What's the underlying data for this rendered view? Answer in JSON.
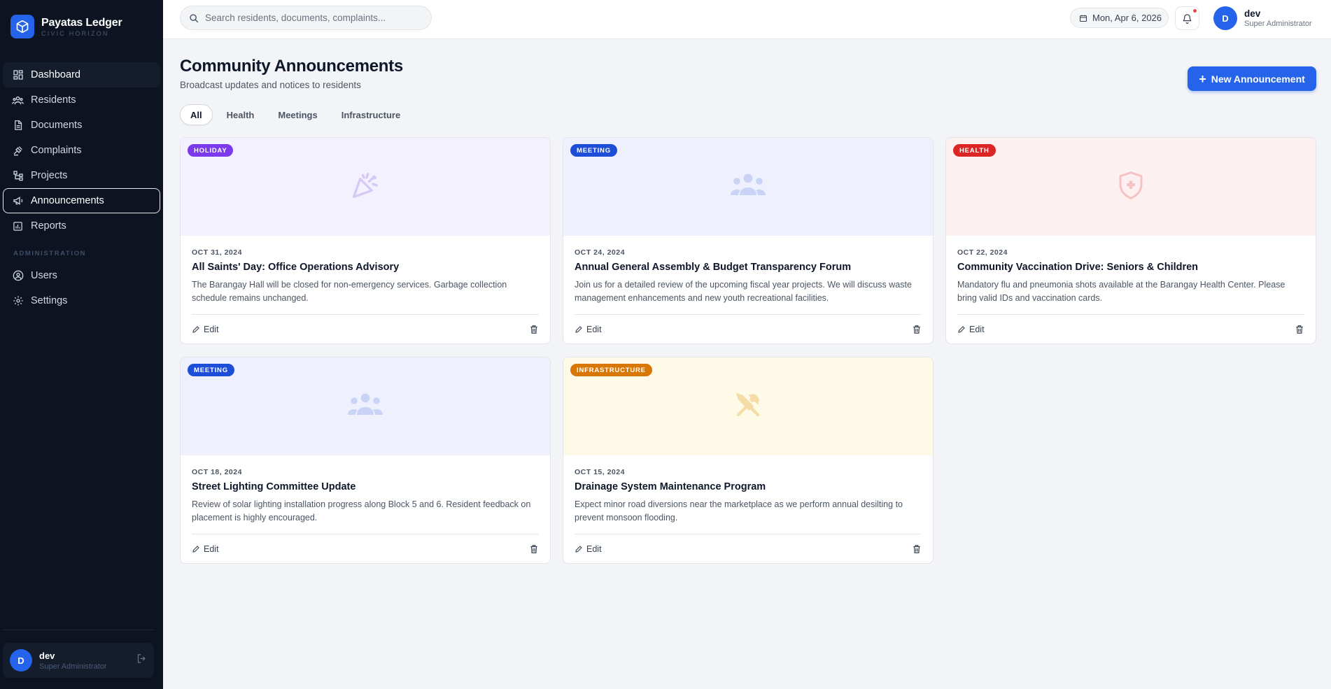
{
  "brand": {
    "name": "Payatas Ledger",
    "subtitle": "CIVIC HORIZON"
  },
  "sidebar": {
    "items": [
      {
        "label": "Dashboard",
        "icon": "dashboard-icon"
      },
      {
        "label": "Residents",
        "icon": "people-icon"
      },
      {
        "label": "Documents",
        "icon": "document-icon"
      },
      {
        "label": "Complaints",
        "icon": "gavel-icon"
      },
      {
        "label": "Projects",
        "icon": "sitemap-icon"
      },
      {
        "label": "Announcements",
        "icon": "megaphone-icon"
      },
      {
        "label": "Reports",
        "icon": "chart-icon"
      }
    ],
    "admin_heading": "ADMINISTRATION",
    "admin_items": [
      {
        "label": "Users",
        "icon": "users-icon"
      },
      {
        "label": "Settings",
        "icon": "gear-icon"
      }
    ],
    "user": {
      "initial": "D",
      "name": "dev",
      "role": "Super Administrator"
    }
  },
  "header": {
    "search_placeholder": "Search residents, documents, complaints...",
    "date": "Mon, Apr 6, 2026",
    "user": {
      "initial": "D",
      "name": "dev",
      "role": "Super Administrator"
    }
  },
  "main": {
    "title": "Community Announcements",
    "subtitle": "Broadcast updates and notices to residents",
    "new_button": "New Announcement",
    "tabs": [
      "All",
      "Health",
      "Meetings",
      "Infrastructure"
    ],
    "cards": [
      {
        "tag": "HOLIDAY",
        "date": "OCT 31, 2024",
        "title": "All Saints' Day: Office Operations Advisory",
        "desc": "The Barangay Hall will be closed for non-emergency services. Garbage collection schedule remains unchanged.",
        "edit": "Edit",
        "icon": "party-popper-icon"
      },
      {
        "tag": "MEETING",
        "date": "OCT 24, 2024",
        "title": "Annual General Assembly & Budget Transparency Forum",
        "desc": "Join us for a detailed review of the upcoming fiscal year projects. We will discuss waste management enhancements and new youth recreational facilities.",
        "edit": "Edit",
        "icon": "group-icon"
      },
      {
        "tag": "HEALTH",
        "date": "OCT 22, 2024",
        "title": "Community Vaccination Drive: Seniors & Children",
        "desc": "Mandatory flu and pneumonia shots available at the Barangay Health Center. Please bring valid IDs and vaccination cards.",
        "edit": "Edit",
        "icon": "medical-shield-icon"
      },
      {
        "tag": "MEETING",
        "date": "OCT 18, 2024",
        "title": "Street Lighting Committee Update",
        "desc": "Review of solar lighting installation progress along Block 5 and 6. Resident feedback on placement is highly encouraged.",
        "edit": "Edit",
        "icon": "group-icon"
      },
      {
        "tag": "INFRASTRUCTURE",
        "date": "OCT 15, 2024",
        "title": "Drainage System Maintenance Program",
        "desc": "Expect minor road diversions near the marketplace as we perform annual desilting to prevent monsoon flooding.",
        "edit": "Edit",
        "icon": "tools-icon"
      }
    ]
  },
  "colors": {
    "accent": "#2563eb",
    "sidebar_bg": "#0d1320",
    "holiday": "#7c3aed",
    "meeting": "#1d4ed8",
    "health": "#dc2626",
    "infrastructure": "#d97706"
  }
}
